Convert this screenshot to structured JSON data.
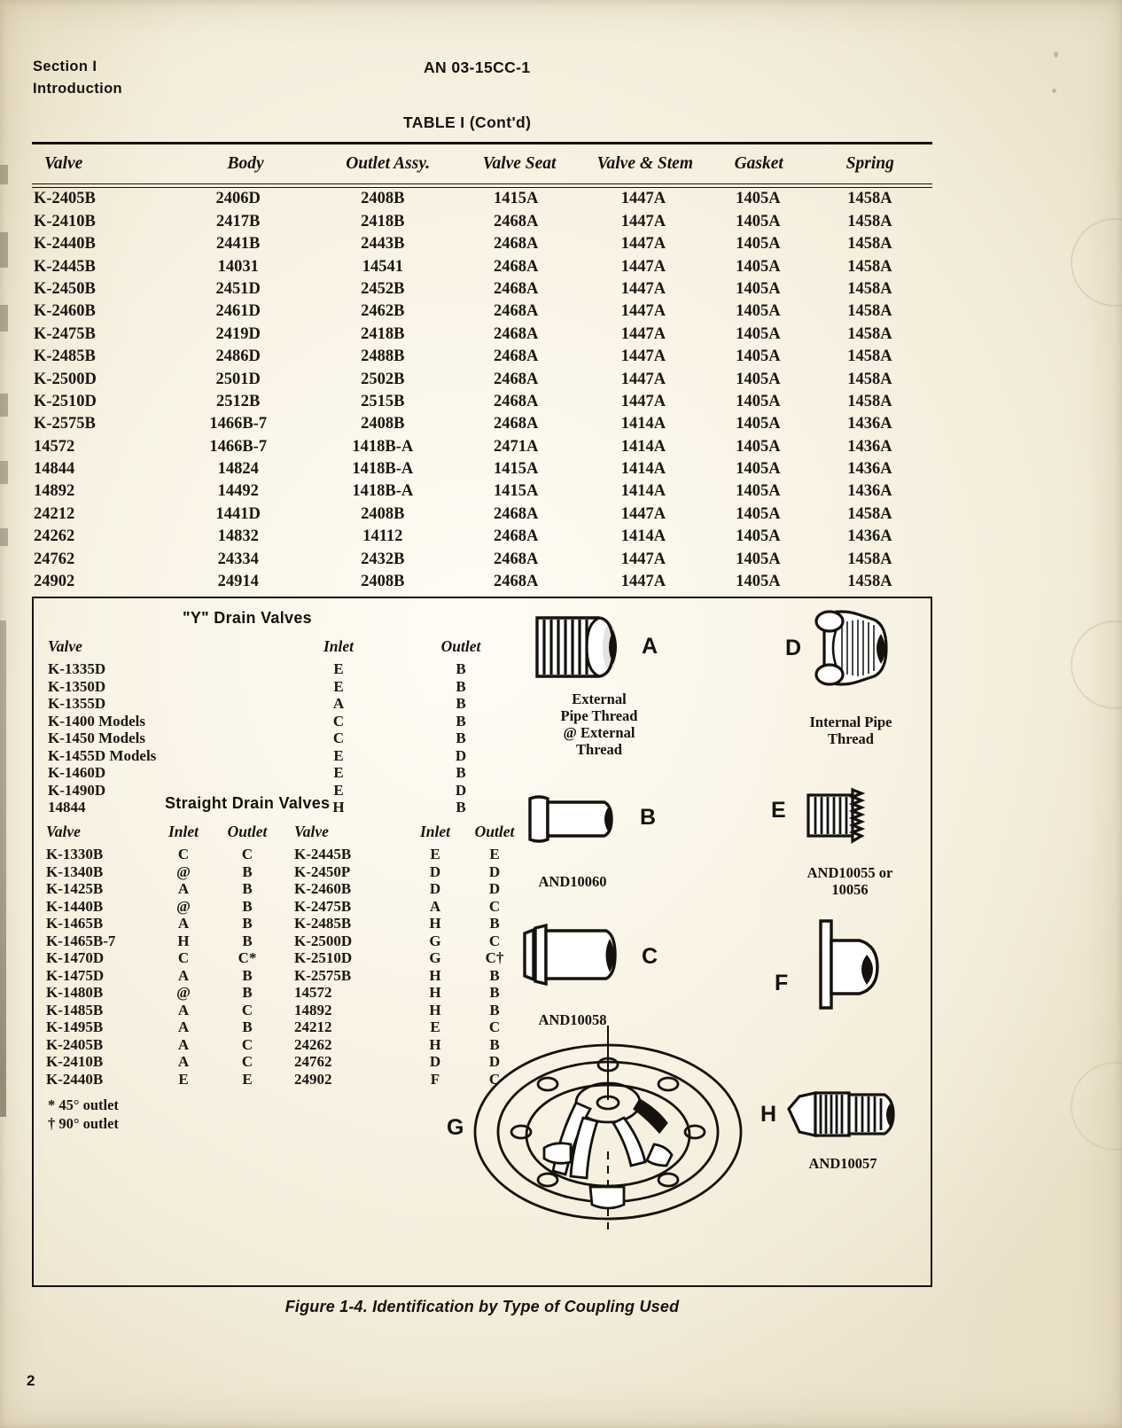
{
  "header": {
    "section": "Section I",
    "subsection": "Introduction",
    "doc_number": "AN 03-15CC-1",
    "table_title": "TABLE I (Cont'd)"
  },
  "main_table": {
    "columns": [
      "Valve",
      "Body",
      "Outlet Assy.",
      "Valve Seat",
      "Valve & Stem",
      "Gasket",
      "Spring"
    ],
    "rows": [
      [
        "K-2405B",
        "2406D",
        "2408B",
        "1415A",
        "1447A",
        "1405A",
        "1458A"
      ],
      [
        "K-2410B",
        "2417B",
        "2418B",
        "2468A",
        "1447A",
        "1405A",
        "1458A"
      ],
      [
        "K-2440B",
        "2441B",
        "2443B",
        "2468A",
        "1447A",
        "1405A",
        "1458A"
      ],
      [
        "K-2445B",
        "14031",
        "14541",
        "2468A",
        "1447A",
        "1405A",
        "1458A"
      ],
      [
        "K-2450B",
        "2451D",
        "2452B",
        "2468A",
        "1447A",
        "1405A",
        "1458A"
      ],
      [
        "K-2460B",
        "2461D",
        "2462B",
        "2468A",
        "1447A",
        "1405A",
        "1458A"
      ],
      [
        "K-2475B",
        "2419D",
        "2418B",
        "2468A",
        "1447A",
        "1405A",
        "1458A"
      ],
      [
        "K-2485B",
        "2486D",
        "2488B",
        "2468A",
        "1447A",
        "1405A",
        "1458A"
      ],
      [
        "K-2500D",
        "2501D",
        "2502B",
        "2468A",
        "1447A",
        "1405A",
        "1458A"
      ],
      [
        "K-2510D",
        "2512B",
        "2515B",
        "2468A",
        "1447A",
        "1405A",
        "1458A"
      ],
      [
        "K-2575B",
        "1466B-7",
        "2408B",
        "2468A",
        "1414A",
        "1405A",
        "1436A"
      ],
      [
        "14572",
        "1466B-7",
        "1418B-A",
        "2471A",
        "1414A",
        "1405A",
        "1436A"
      ],
      [
        "14844",
        "14824",
        "1418B-A",
        "1415A",
        "1414A",
        "1405A",
        "1436A"
      ],
      [
        "14892",
        "14492",
        "1418B-A",
        "1415A",
        "1414A",
        "1405A",
        "1436A"
      ],
      [
        "24212",
        "1441D",
        "2408B",
        "2468A",
        "1447A",
        "1405A",
        "1458A"
      ],
      [
        "24262",
        "14832",
        "14112",
        "2468A",
        "1414A",
        "1405A",
        "1436A"
      ],
      [
        "24762",
        "24334",
        "2432B",
        "2468A",
        "1447A",
        "1405A",
        "1458A"
      ],
      [
        "24902",
        "24914",
        "2408B",
        "2468A",
        "1447A",
        "1405A",
        "1458A"
      ]
    ]
  },
  "y_drain": {
    "title": "\"Y\" Drain Valves",
    "columns": [
      "Valve",
      "Inlet",
      "Outlet"
    ],
    "rows": [
      [
        "K-1335D",
        "E",
        "B"
      ],
      [
        "K-1350D",
        "E",
        "B"
      ],
      [
        "K-1355D",
        "A",
        "B"
      ],
      [
        "K-1400  Models",
        "C",
        "B"
      ],
      [
        "K-1450  Models",
        "C",
        "B"
      ],
      [
        "K-1455D Models",
        "E",
        "D"
      ],
      [
        "K-1460D",
        "E",
        "B"
      ],
      [
        "K-1490D",
        "E",
        "D"
      ],
      [
        "14844",
        "H",
        "B"
      ]
    ]
  },
  "straight_drain": {
    "title": "Straight Drain Valves",
    "columns": [
      "Valve",
      "Inlet",
      "Outlet",
      "Valve",
      "Inlet",
      "Outlet"
    ],
    "rows": [
      [
        "K-1330B",
        "C",
        "C",
        "K-2445B",
        "E",
        "E"
      ],
      [
        "K-1340B",
        "@",
        "B",
        "K-2450P",
        "D",
        "D"
      ],
      [
        "K-1425B",
        "A",
        "B",
        "K-2460B",
        "D",
        "D"
      ],
      [
        "K-1440B",
        "@",
        "B",
        "K-2475B",
        "A",
        "C"
      ],
      [
        "K-1465B",
        "A",
        "B",
        "K-2485B",
        "H",
        "B"
      ],
      [
        "K-1465B-7",
        "H",
        "B",
        "K-2500D",
        "G",
        "C"
      ],
      [
        "K-1470D",
        "C",
        "C*",
        "K-2510D",
        "G",
        "C†"
      ],
      [
        "K-1475D",
        "A",
        "B",
        "K-2575B",
        "H",
        "B"
      ],
      [
        "K-1480B",
        "@",
        "B",
        "14572",
        "H",
        "B"
      ],
      [
        "K-1485B",
        "A",
        "C",
        "14892",
        "H",
        "B"
      ],
      [
        "K-1495B",
        "A",
        "B",
        "24212",
        "E",
        "C"
      ],
      [
        "K-2405B",
        "A",
        "C",
        "24262",
        "H",
        "B"
      ],
      [
        "K-2410B",
        "A",
        "C",
        "24762",
        "D",
        "D"
      ],
      [
        "K-2440B",
        "E",
        "E",
        "24902",
        "F",
        "C"
      ]
    ],
    "footnotes": [
      "* 45° outlet",
      "† 90° outlet"
    ]
  },
  "couplings": [
    {
      "letter": "A",
      "caption": "External\nPipe Thread\n@ External\nThread",
      "icon": "external-pipe-thread-fitting"
    },
    {
      "letter": "B",
      "caption": "AND10060",
      "icon": "plain-sleeve-fitting"
    },
    {
      "letter": "C",
      "caption": "AND10058",
      "icon": "flanged-sleeve-fitting"
    },
    {
      "letter": "D",
      "caption": "Internal Pipe\nThread",
      "icon": "internal-pipe-thread-fitting"
    },
    {
      "letter": "E",
      "caption": "AND10055 or\n10056",
      "icon": "threaded-nipple-fitting"
    },
    {
      "letter": "F",
      "caption": "",
      "icon": "bulkhead-flange-fitting"
    },
    {
      "letter": "G",
      "caption": "",
      "icon": "bolted-flange-plate"
    },
    {
      "letter": "H",
      "caption": "AND10057",
      "icon": "flared-tube-coupling"
    }
  ],
  "figure_caption": "Figure 1-4. Identification by Type of Coupling Used",
  "page_number": "2"
}
